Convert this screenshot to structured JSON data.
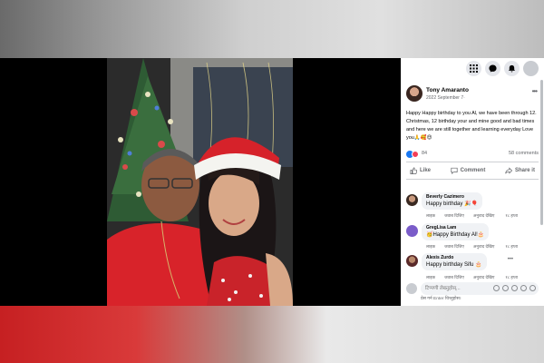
{
  "post": {
    "author": "Tony Amaranto",
    "date": "2022 September 7·",
    "text": "Happy Happy birthday to you Al, we have been through 12. Christmas, 12 birthday your and mine good and bad times and here we are still together and learning everyday Love you🙏🥰😍",
    "reaction_count": "84",
    "comments_count": "58 comments"
  },
  "actions": {
    "like": "Like",
    "comment": "Comment",
    "share": "Share it"
  },
  "comments": [
    {
      "name": "Beverly Cazimero",
      "text": "Happy birthday 🎉🎈",
      "like": "लाइक",
      "reply": "जवाब दिजिए",
      "translation": "अनुवाद देखिए",
      "time": "१८ हप्ता"
    },
    {
      "name": "GregLisa Lam",
      "text": "🥳Happy Birthday Al!🎂",
      "like": "लाइक",
      "reply": "जवाब दिजिए",
      "translation": "अनुवाद देखिए",
      "time": "१८ हप्ता"
    },
    {
      "name": "Alexis Zurdo",
      "text": "Happy birthday Sifu 🎂",
      "like": "लाइक",
      "reply": "जवाब दिजिए",
      "translation": "अनुवाद देखिए",
      "time": "१८ हप्ता"
    }
  ],
  "write_comment": {
    "placeholder": "टिप्पणी लेख्नुहोस्...",
    "hint": "प्रेस गर्न Enter थिच्नुहोस।"
  },
  "colors": {
    "accent": "#1877f2",
    "heart": "#f33e58",
    "viewer_bg": "#000000"
  },
  "icons": [
    "menu-grid-icon",
    "messenger-icon",
    "bell-icon",
    "like-icon",
    "comment-icon",
    "share-icon",
    "more-icon"
  ]
}
